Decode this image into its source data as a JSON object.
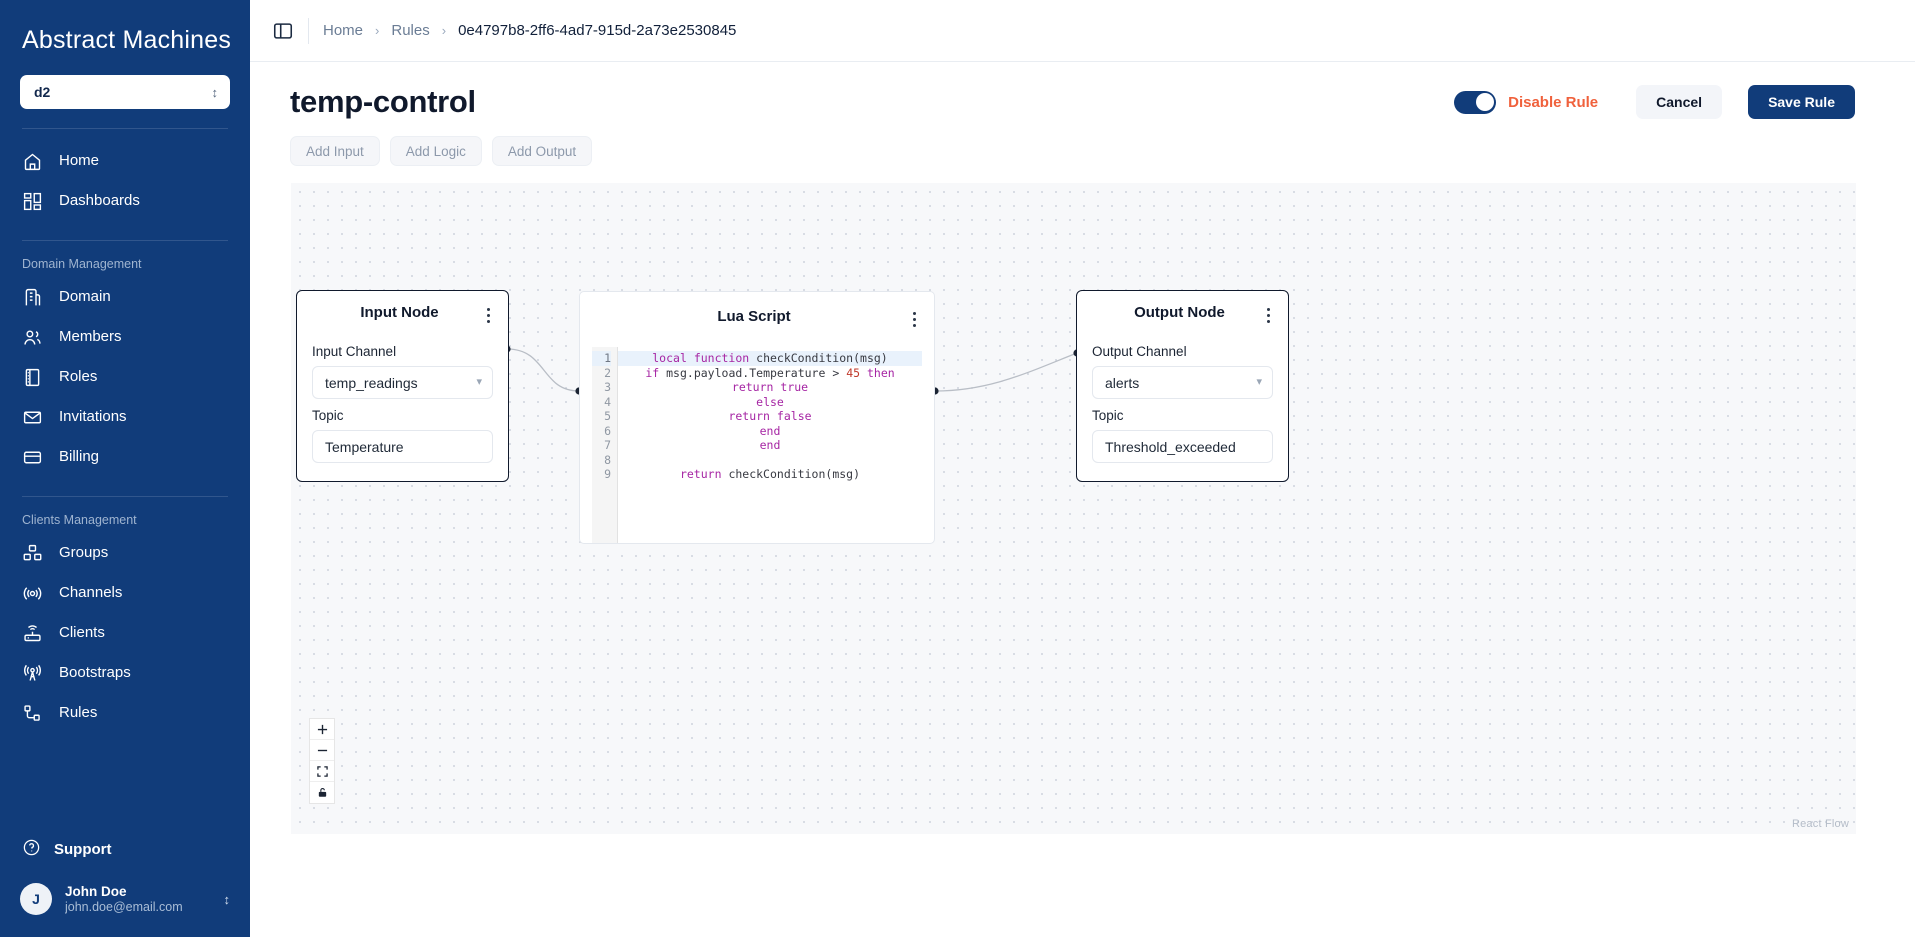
{
  "sidebar": {
    "brand": "Abstract Machines",
    "domain_selector": {
      "value": "d2",
      "icon": "updown-chevron-icon"
    },
    "top_items": [
      {
        "label": "Home",
        "icon": "home-icon"
      },
      {
        "label": "Dashboards",
        "icon": "dashboards-icon"
      }
    ],
    "groups": [
      {
        "label": "Domain Management",
        "items": [
          {
            "label": "Domain",
            "icon": "building-icon"
          },
          {
            "label": "Members",
            "icon": "users-icon"
          },
          {
            "label": "Roles",
            "icon": "book-icon"
          },
          {
            "label": "Invitations",
            "icon": "envelope-icon"
          },
          {
            "label": "Billing",
            "icon": "credit-card-icon"
          }
        ]
      },
      {
        "label": "Clients Management",
        "items": [
          {
            "label": "Groups",
            "icon": "boxes-icon"
          },
          {
            "label": "Channels",
            "icon": "broadcast-icon"
          },
          {
            "label": "Clients",
            "icon": "router-icon"
          },
          {
            "label": "Bootstraps",
            "icon": "antenna-icon"
          },
          {
            "label": "Rules",
            "icon": "nodes-icon"
          }
        ]
      }
    ],
    "support": {
      "label": "Support",
      "icon": "question-circle-icon"
    },
    "user": {
      "initial": "J",
      "name": "John Doe",
      "email": "john.doe@email.com",
      "icon": "updown-chevron-icon"
    }
  },
  "topbar": {
    "panel_toggle_icon": "sidebar-panel-icon",
    "breadcrumb": [
      {
        "label": "Home",
        "current": false
      },
      {
        "label": "Rules",
        "current": false
      },
      {
        "label": "0e4797b8-2ff6-4ad7-915d-2a73e2530845",
        "current": true
      }
    ],
    "separator": "›"
  },
  "page": {
    "title": "temp-control",
    "toggle": {
      "label": "Disable Rule",
      "state": "on",
      "color": "#f0613c"
    },
    "cancel_label": "Cancel",
    "save_label": "Save Rule",
    "add_buttons": [
      "Add Input",
      "Add Logic",
      "Add Output"
    ]
  },
  "canvas": {
    "attribution": "React Flow",
    "controls": [
      {
        "name": "zoom-in",
        "glyph": "+"
      },
      {
        "name": "zoom-out",
        "glyph": "−"
      },
      {
        "name": "fit-view",
        "glyph": "fit"
      },
      {
        "name": "lock",
        "glyph": "lock"
      }
    ],
    "nodes": {
      "input": {
        "title": "Input Node",
        "channel_label": "Input Channel",
        "channel_value": "temp_readings",
        "topic_label": "Topic",
        "topic_value": "Temperature"
      },
      "lua": {
        "title": "Lua Script",
        "lines": [
          {
            "n": "1",
            "text": "local function checkCondition(msg)"
          },
          {
            "n": "2",
            "text": "if msg.payload.Temperature > 45 then"
          },
          {
            "n": "3",
            "text": "return true"
          },
          {
            "n": "4",
            "text": "else"
          },
          {
            "n": "5",
            "text": "return false"
          },
          {
            "n": "6",
            "text": "end"
          },
          {
            "n": "7",
            "text": "end"
          },
          {
            "n": "8",
            "text": ""
          },
          {
            "n": "9",
            "text": "return checkCondition(msg)"
          }
        ]
      },
      "output": {
        "title": "Output Node",
        "channel_label": "Output Channel",
        "channel_value": "alerts",
        "topic_label": "Topic",
        "topic_value": "Threshold_exceeded"
      }
    }
  },
  "colors": {
    "sidebar_bg": "#113c7a",
    "accent": "#113c7a",
    "danger": "#f0613c",
    "canvas_bg": "#f7f8fa"
  }
}
